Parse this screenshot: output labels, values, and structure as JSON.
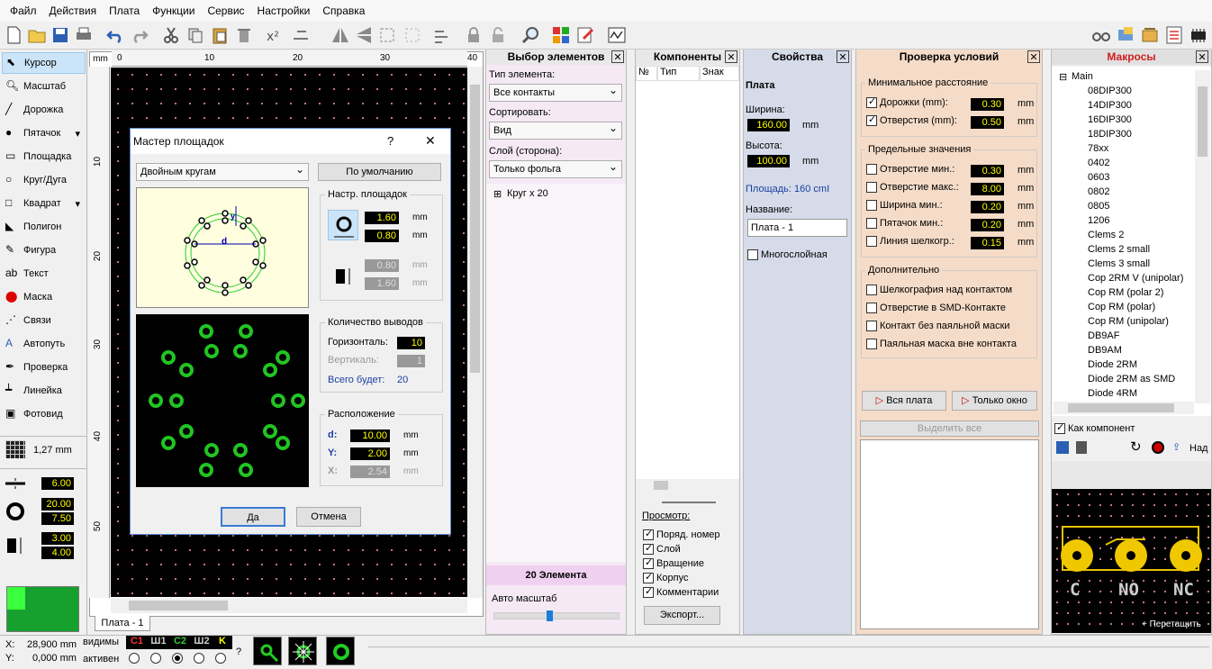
{
  "menu": [
    "Файл",
    "Действия",
    "Плата",
    "Функции",
    "Сервис",
    "Настройки",
    "Справка"
  ],
  "tools": [
    {
      "label": "Курсор",
      "icon": "cursor-icon"
    },
    {
      "label": "Масштаб",
      "icon": "zoom-icon"
    },
    {
      "label": "Дорожка",
      "icon": "track-icon"
    },
    {
      "label": "Пятачок",
      "icon": "pad-icon"
    },
    {
      "label": "Площадка",
      "icon": "smd-pad-icon"
    },
    {
      "label": "Круг/Дуга",
      "icon": "circle-icon"
    },
    {
      "label": "Квадрат",
      "icon": "square-icon"
    },
    {
      "label": "Полигон",
      "icon": "polygon-icon"
    },
    {
      "label": "Фигура",
      "icon": "figure-icon"
    },
    {
      "label": "Текст",
      "icon": "text-icon"
    },
    {
      "label": "Маска",
      "icon": "mask-icon"
    },
    {
      "label": "Связи",
      "icon": "connections-icon"
    },
    {
      "label": "Автопуть",
      "icon": "autoroute-icon"
    },
    {
      "label": "Проверка",
      "icon": "check-icon"
    },
    {
      "label": "Линейка",
      "icon": "ruler-icon"
    },
    {
      "label": "Фотовид",
      "icon": "photo-view-icon"
    }
  ],
  "grid": {
    "value": "1,27 mm"
  },
  "left_values": {
    "track": "6.00",
    "pad_outer": "20.00",
    "pad_inner": "7.50",
    "smd_w": "3.00",
    "smd_h": "4.00"
  },
  "ruler": {
    "unit": "mm",
    "h": [
      "0",
      "10",
      "20",
      "30",
      "40"
    ],
    "v": [
      "10",
      "20",
      "30",
      "40",
      "50"
    ]
  },
  "tab": "Плата - 1",
  "dialog": {
    "title": "Мастер площадок",
    "help": "?",
    "close": "✕",
    "shape": "Двойным кругам",
    "default_btn": "По умолчанию",
    "pad_settings": "Настр. площадок",
    "d_label": "d",
    "y_label": "y",
    "pad1": "1.60",
    "pad2": "0.80",
    "smd1": "0.80",
    "smd2": "1.60",
    "unit": "mm",
    "count_title": "Количество выводов",
    "horiz_label": "Горизонталь:",
    "horiz": "10",
    "vert_label": "Вертикаль:",
    "vert": "1",
    "total_label": "Всего будет:",
    "total": "20",
    "layout_title": "Расположение",
    "d": "d:",
    "d_val": "10.00",
    "y": "Y:",
    "y_val": "2.00",
    "x": "X:",
    "x_val": "2.54",
    "ok": "Да",
    "cancel": "Отмена"
  },
  "select_panel": {
    "title": "Выбор элементов",
    "type_label": "Тип элемента:",
    "type": "Все контакты",
    "sort_label": "Сортировать:",
    "sort": "Вид",
    "layer_label": "Слой (сторона):",
    "layer": "Только фольга",
    "item": "Круг   x 20",
    "count": "20 Элемента",
    "auto": "Авто масштаб"
  },
  "components": {
    "title": "Компоненты",
    "cols": [
      "№",
      "Тип",
      "Знак"
    ],
    "view": "Просмотр:",
    "checks": [
      "Поряд. номер",
      "Слой",
      "Вращение",
      "Корпус",
      "Комментарии"
    ],
    "export": "Экспорт..."
  },
  "props": {
    "title": "Свойства",
    "section": "Плата",
    "width_label": "Ширина:",
    "width": "160.00",
    "height_label": "Высота:",
    "height": "100.00",
    "unit": "mm",
    "area": "Площадь:   160 cmI",
    "name_label": "Название:",
    "name": "Плата - 1",
    "multilayer": "Многослойная"
  },
  "drc": {
    "title": "Проверка условий",
    "min_title": "Минимальное расстояние",
    "min": [
      {
        "label": "Дорожки (mm):",
        "v": "0.30",
        "on": true
      },
      {
        "label": "Отверстия (mm):",
        "v": "0.50",
        "on": true
      }
    ],
    "lim_title": "Предельные значения",
    "lim": [
      {
        "label": "Отверстие мин.:",
        "v": "0.30"
      },
      {
        "label": "Отверстие макс.:",
        "v": "8.00"
      },
      {
        "label": "Ширина мин.:",
        "v": "0.20"
      },
      {
        "label": "Пятачок мин.:",
        "v": "0.20"
      },
      {
        "label": "Линия шелкогр.:",
        "v": "0.15"
      }
    ],
    "extra_title": "Дополнительно",
    "extra": [
      "Шелкография над контактом",
      "Отверстие в SMD-Контакте",
      "Контакт без паяльной маски",
      "Паяльная маска вне контакта"
    ],
    "all": "Вся плата",
    "window": "Только окно",
    "select_all": "Выделить все",
    "unit": "mm"
  },
  "macros": {
    "title": "Макросы",
    "root": "Main",
    "items": [
      "08DIP300",
      "14DIP300",
      "16DIP300",
      "18DIP300",
      "78xx",
      "0402",
      "0603",
      "0802",
      "0805",
      "1206",
      "Clems 2",
      "Clems 2 small",
      "Clems 3 small",
      "Cop 2RM V (unipolar)",
      "Cop RM (polar 2)",
      "Cop RM (polar)",
      "Cop RM (unipolar)",
      "DB9AF",
      "DB9AM",
      "Diode 2RM",
      "Diode 2RM as SMD",
      "Diode 4RM"
    ],
    "as_component": "Как компонент",
    "above": "Над",
    "drag": "+ Перетащить",
    "pins": [
      "C",
      "NO",
      "NC"
    ]
  },
  "status": {
    "x_label": "X:",
    "x": "28,900 mm",
    "y_label": "Y:",
    "y": "0,000 mm",
    "visible": "видимы",
    "active": "активен",
    "layers": [
      "C1",
      "Ш1",
      "C2",
      "Ш2",
      "K"
    ],
    "q": "?"
  }
}
